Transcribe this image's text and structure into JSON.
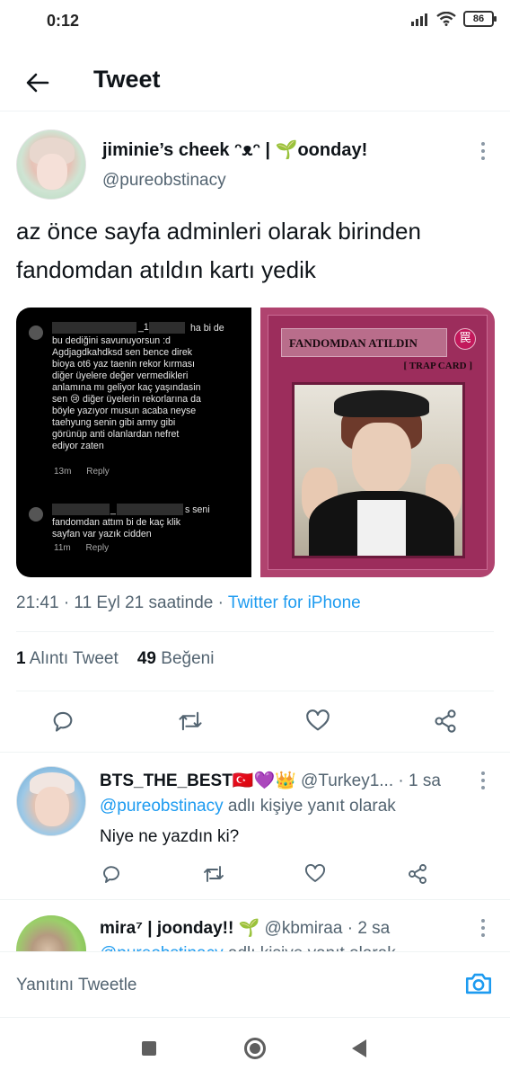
{
  "status_bar": {
    "time": "0:12",
    "battery": "86"
  },
  "header": {
    "title": "Tweet"
  },
  "tweet": {
    "display_name": "jiminie’s cheek ᵔᴥᵔ | 🌱oonday!",
    "handle": "@pureobstinacy",
    "text": "az önce sayfa adminleri olarak birinden fandomdan atıldın kartı yedik",
    "media": {
      "left_image": {
        "comment1_prefix": "_1",
        "comment1_suffix": "ha bi de",
        "comment1_body": "bu dediğini savunuyorsun :d\nAgdjagdkahdksd sen bence direk\nbioya ot6 yaz taenin rekor kırması\ndiğer üyelere değer vermedikleri\nanlamına mı geliyor kaç yaşındasin\nsen 😢 diğer üyelerin rekorlarına da\nböyle yazıyor musun acaba neyse\ntaehyung senin gibi army gibi\ngörünüp anti olanlardan nefret\nediyor zaten",
        "comment1_time": "13m",
        "comment1_reply": "Reply",
        "comment2_prefix": "_",
        "comment2_suffix": "s seni",
        "comment2_body": "fandomdan attım bi de kaç klik\nsayfan var yazık cidden",
        "comment2_time": "11m",
        "comment2_reply": "Reply"
      },
      "right_image": {
        "card_title": "FANDOMDAN ATILDIN",
        "card_symbol": "罠",
        "card_symbol_caption": "TRAP",
        "card_type": "[ TRAP CARD ]"
      }
    },
    "timestamp": "21:41 · 11 Eyl 21 saatinde · ",
    "source": "Twitter for iPhone",
    "stats": {
      "quote_count": "1",
      "quote_label": " Alıntı Tweet",
      "like_count": "49",
      "like_label": " Beğeni"
    }
  },
  "actions": {
    "reply_icon": "reply-icon",
    "retweet_icon": "retweet-icon",
    "like_icon": "heart-icon",
    "share_icon": "share-icon"
  },
  "replies": [
    {
      "display_name": "BTS_THE_BEST🇹🇷💜👑",
      "handle": " @Turkey1...",
      "time": " · 1 sa",
      "replying_mention": "@pureobstinacy",
      "replying_suffix": " adlı kişiye yanıt olarak",
      "text": "Niye ne yazdın ki?"
    },
    {
      "display_name": "mira⁷ | joonday!! 🌱",
      "handle": " @kbmiraa",
      "time": " · 2 sa",
      "replying_mention": "@pureobstinacy",
      "replying_suffix": " adlı kişiye yanıt olarak"
    }
  ],
  "compose": {
    "placeholder": "Yanıtını Tweetle"
  },
  "colors": {
    "accent": "#1d9bf0",
    "text": "#0f1419",
    "secondary": "#536471",
    "card": "#9c2d5c"
  }
}
